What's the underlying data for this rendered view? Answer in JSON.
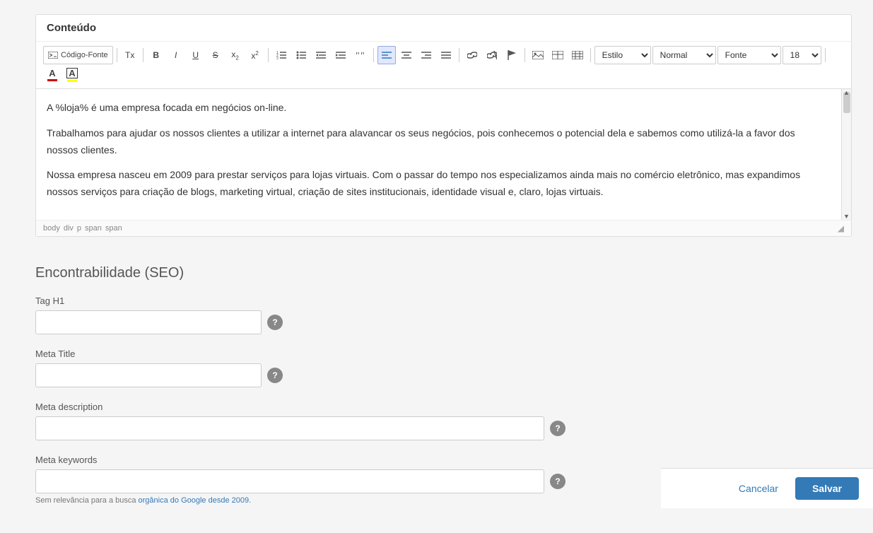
{
  "content_section": {
    "title": "Conteúdo"
  },
  "toolbar": {
    "code_source_label": "Código-Fonte",
    "clear_label": "Tx",
    "bold": "B",
    "italic": "I",
    "underline": "U",
    "strikethrough": "S",
    "subscript": "x₂",
    "superscript": "x²",
    "list_ordered": "≡",
    "list_unordered": "≡",
    "indent_decrease": "←",
    "indent_increase": "→",
    "blockquote": "❝",
    "align_left": "▤",
    "align_center": "≡",
    "align_right": "≡",
    "align_justify": "≡",
    "link_add": "🔗",
    "link_remove": "🔗",
    "flag": "🚩",
    "image": "🖼",
    "table_draw": "⊞",
    "table": "⊟",
    "style_label": "Estilo",
    "format_label": "Normal",
    "font_label": "Fonte",
    "font_size_value": "18",
    "font_color": "A",
    "font_bg_color": "A"
  },
  "editor": {
    "paragraph1": "A %loja% é uma empresa focada em negócios on-line.",
    "paragraph2": "Trabalhamos para ajudar os nossos clientes a utilizar a internet para alavancar os seus negócios, pois conhecemos o potencial dela e sabemos como utilizá-la a favor dos nossos clientes.",
    "paragraph3": "Nossa empresa nasceu em 2009 para prestar serviços para lojas virtuais. Com o passar do tempo nos especializamos ainda mais no comércio eletrônico, mas expandimos nossos serviços para criação de blogs, marketing virtual, criação de sites institucionais, identidade visual e, claro, lojas virtuais.",
    "path_items": [
      "body",
      "div",
      "p",
      "span",
      "span"
    ]
  },
  "seo": {
    "title": "Encontrabilidade (SEO)",
    "tag_h1_label": "Tag H1",
    "tag_h1_value": "",
    "tag_h1_placeholder": "",
    "meta_title_label": "Meta Title",
    "meta_title_value": "",
    "meta_title_placeholder": "",
    "meta_description_label": "Meta description",
    "meta_description_value": "",
    "meta_description_placeholder": "",
    "meta_keywords_label": "Meta keywords",
    "meta_keywords_value": "",
    "meta_keywords_placeholder": "",
    "keywords_note": "Sem relevância para a busca orgânica do Google desde 2009."
  },
  "actions": {
    "cancel_label": "Cancelar",
    "save_label": "Salvar"
  }
}
